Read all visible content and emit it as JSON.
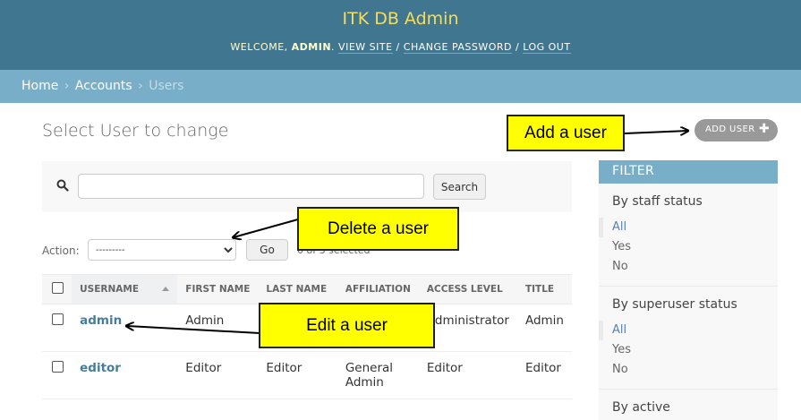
{
  "header": {
    "site_name": "ITK DB Admin",
    "welcome": "WELCOME,",
    "username": "ADMIN",
    "links": {
      "view_site": "VIEW SITE",
      "change_password": "CHANGE PASSWORD",
      "log_out": "LOG OUT"
    },
    "separator": "/",
    "colors": {
      "bar": "#417690",
      "brand": "#f5dd5d"
    }
  },
  "breadcrumbs": {
    "home": "Home",
    "accounts": "Accounts",
    "current": "Users",
    "arrow": "›"
  },
  "page": {
    "title": "Select User to change",
    "add_button": "ADD USER"
  },
  "search": {
    "value": "",
    "button": "Search",
    "icon": "search-icon"
  },
  "actions": {
    "label": "Action:",
    "selected_option": "---------",
    "go_button": "Go",
    "selection_count": "0 of 3 selected"
  },
  "table": {
    "columns": [
      "USERNAME",
      "FIRST NAME",
      "LAST NAME",
      "AFFILIATION",
      "ACCESS LEVEL",
      "TITLE"
    ],
    "rows": [
      {
        "username": "admin",
        "first_name": "Admin",
        "last_name": "",
        "affiliation": "",
        "access_level": "Administrator",
        "title": "Admin"
      },
      {
        "username": "editor",
        "first_name": "Editor",
        "last_name": "Editor",
        "affiliation": "General Admin",
        "access_level": "Editor",
        "title": "Editor"
      }
    ]
  },
  "filter": {
    "title": "FILTER",
    "groups": [
      {
        "heading": "By staff status",
        "options": [
          "All",
          "Yes",
          "No"
        ],
        "selected": "All"
      },
      {
        "heading": "By superuser status",
        "options": [
          "All",
          "Yes",
          "No"
        ],
        "selected": "All"
      },
      {
        "heading": "By active"
      }
    ]
  },
  "annotations": {
    "add": "Add a user",
    "delete": "Delete a user",
    "edit": "Edit a user",
    "color": "#ffff00"
  }
}
